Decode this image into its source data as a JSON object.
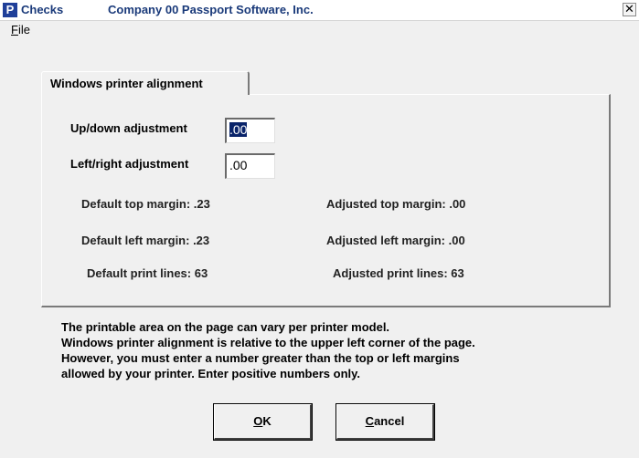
{
  "titlebar": {
    "logo_letter": "P",
    "app_name": "Checks",
    "title": "Company 00  Passport Software, Inc.",
    "close_glyph": "✕"
  },
  "menu": {
    "file": "File"
  },
  "tab": {
    "label": "Windows printer alignment"
  },
  "fields": {
    "updown_label": "Up/down adjustment",
    "updown_value": ".00",
    "leftright_label": "Left/right adjustment",
    "leftright_value": ".00"
  },
  "info": {
    "default_top_margin": "Default top margin:  .23",
    "adjusted_top_margin": "Adjusted top margin:  .00",
    "default_left_margin": "Default left margin:  .23",
    "adjusted_left_margin": "Adjusted left margin:  .00",
    "default_print_lines": "Default print lines:  63",
    "adjusted_print_lines": "Adjusted print lines:  63"
  },
  "note": {
    "line1": "The printable area on the page can vary per printer model.",
    "line2": "Windows printer alignment is relative to the upper left corner of the page.",
    "line3": "However, you must enter a number greater than the top or left margins",
    "line4": "allowed by your printer. Enter positive numbers only."
  },
  "buttons": {
    "ok": "OK",
    "cancel": "Cancel"
  },
  "colors": {
    "title_text": "#1a3a7a",
    "logo_bg": "#1f3f99",
    "selection": "#0a246a"
  }
}
